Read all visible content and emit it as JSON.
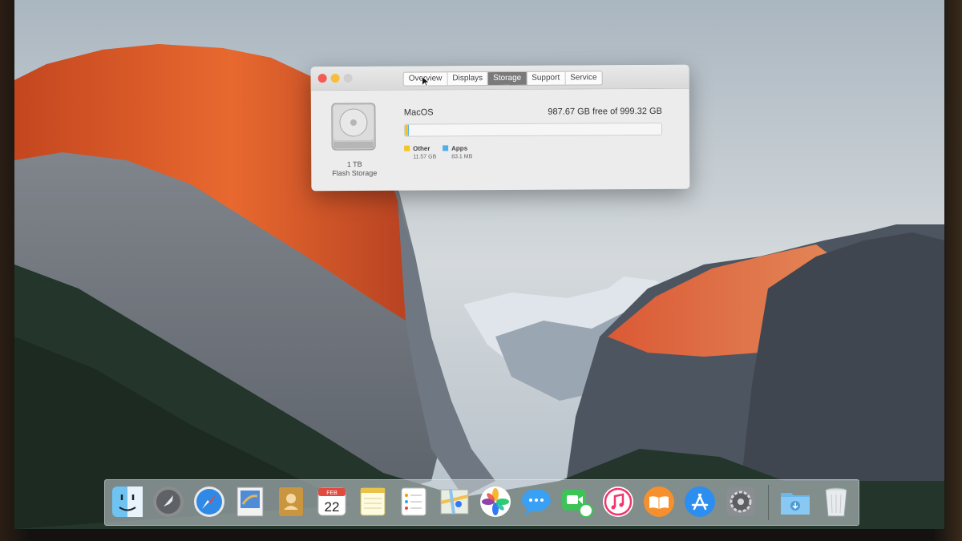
{
  "window": {
    "tabs": [
      {
        "label": "Overview",
        "active": false
      },
      {
        "label": "Displays",
        "active": false
      },
      {
        "label": "Storage",
        "active": true
      },
      {
        "label": "Support",
        "active": false
      },
      {
        "label": "Service",
        "active": false
      }
    ],
    "disk": {
      "size": "1 TB",
      "type": "Flash Storage"
    },
    "volume": {
      "name": "MacOS",
      "free_text": "987.67 GB free of 999.32 GB"
    },
    "usage": {
      "total_gb": 999.32,
      "other_gb": 11.57,
      "apps_gb": 0.0831
    },
    "legend": [
      {
        "label": "Other",
        "value": "11.57 GB",
        "color": "#f3c623"
      },
      {
        "label": "Apps",
        "value": "83.1 MB",
        "color": "#4fb0e8"
      }
    ]
  },
  "dock": {
    "items": [
      "finder-icon",
      "launchpad-icon",
      "safari-icon",
      "mail-icon",
      "contacts-icon",
      "calendar-icon",
      "notes-icon",
      "reminders-icon",
      "maps-icon",
      "photos-icon",
      "messages-icon",
      "facetime-icon",
      "itunes-icon",
      "ibooks-icon",
      "app-store-icon",
      "system-preferences-icon",
      "downloads-folder-icon",
      "trash-icon"
    ],
    "calendar": {
      "month": "FEB",
      "day": "22"
    }
  }
}
